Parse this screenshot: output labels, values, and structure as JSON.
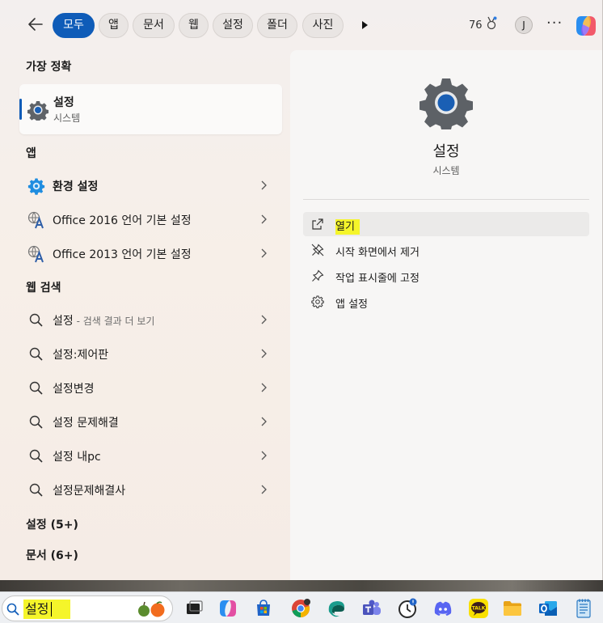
{
  "filters": {
    "active": "모두",
    "chips": [
      "모두",
      "앱",
      "문서",
      "웹",
      "설정",
      "폴더",
      "사진"
    ]
  },
  "rewards": {
    "points": "76"
  },
  "user": {
    "initial": "J"
  },
  "best_match": {
    "heading": "가장 정확",
    "name": "설정",
    "subtitle": "시스템"
  },
  "apps": {
    "heading": "앱",
    "items": [
      {
        "label": "환경 설정",
        "icon": "settings-gear-icon"
      },
      {
        "label": "Office 2016 언어 기본 설정",
        "icon": "office-language-icon"
      },
      {
        "label": "Office 2013 언어 기본 설정",
        "icon": "office-language-icon"
      }
    ]
  },
  "web_search": {
    "heading": "웹 검색",
    "items": [
      {
        "label": "설정",
        "hint": " - 검색 결과 더 보기"
      },
      {
        "label": "설정:제어판",
        "hint": ""
      },
      {
        "label": "설정변경",
        "hint": ""
      },
      {
        "label": "설정 문제해결",
        "hint": ""
      },
      {
        "label": "설정 내pc",
        "hint": ""
      },
      {
        "label": "설정문제해결사",
        "hint": ""
      }
    ]
  },
  "more_sections": [
    {
      "label": "설정 (5+)"
    },
    {
      "label": "문서 (6+)"
    }
  ],
  "preview": {
    "name": "설정",
    "subtitle": "시스템",
    "actions": [
      {
        "label": "열기",
        "icon": "open-external-icon"
      },
      {
        "label": "시작 화면에서 제거",
        "icon": "unpin-icon"
      },
      {
        "label": "작업 표시줄에 고정",
        "icon": "pin-icon"
      },
      {
        "label": "앱 설정",
        "icon": "gear-icon"
      }
    ]
  },
  "taskbar": {
    "search_query": "설정",
    "apps": [
      "task-view",
      "copilot",
      "microsoft-store",
      "chrome",
      "edge-dev",
      "teams",
      "clock",
      "discord",
      "kakaotalk",
      "file-explorer",
      "outlook",
      "notepad"
    ]
  },
  "colors": {
    "accent": "#0f5cb8",
    "highlight": "#f5f52a"
  }
}
